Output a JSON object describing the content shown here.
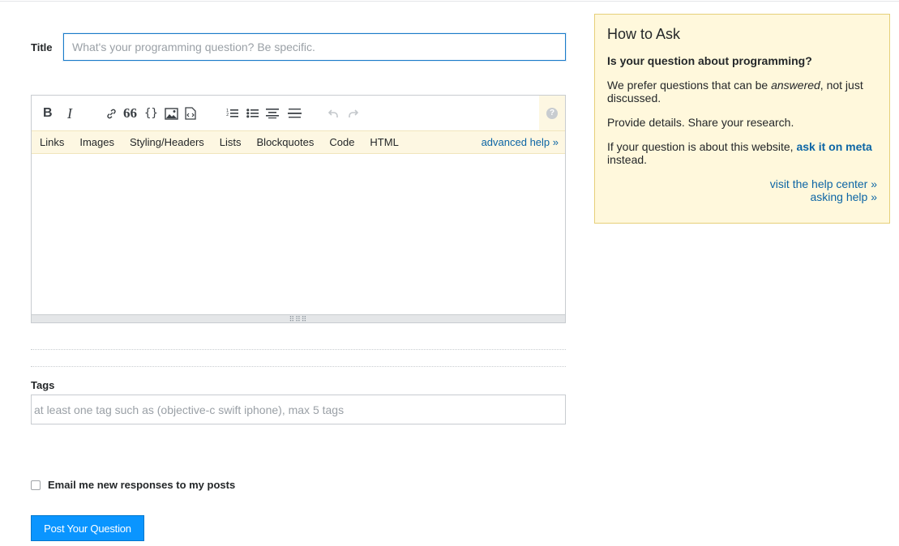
{
  "form": {
    "title_label": "Title",
    "title_placeholder": "What's your programming question? Be specific.",
    "editor": {
      "toolbar": {
        "bold": "B",
        "italic": "I",
        "blockquote": "66",
        "code": "{}",
        "help": "?"
      },
      "help_tabs": [
        "Links",
        "Images",
        "Styling/Headers",
        "Lists",
        "Blockquotes",
        "Code",
        "HTML"
      ],
      "advanced_help": "advanced help »"
    },
    "tags_label": "Tags",
    "tags_placeholder": "at least one tag such as (objective-c swift iphone), max 5 tags",
    "email_label": "Email me new responses to my posts",
    "submit_label": "Post Your Question"
  },
  "sidebar": {
    "title": "How to Ask",
    "subtitle": "Is your question about programming?",
    "p1_before": "We prefer questions that can be ",
    "p1_em": "answered",
    "p1_after": ", not just discussed.",
    "p2": "Provide details. Share your research.",
    "p3_before": "If your question is about this website, ",
    "p3_link": "ask it on meta",
    "p3_after": " instead.",
    "link_help_center": "visit the help center »",
    "link_asking_help": "asking help »"
  },
  "colors": {
    "accent": "#0a95ff",
    "link": "#0c65a5",
    "sidebar_bg": "#fff8dc",
    "helpbar_bg": "#fdf7e2"
  }
}
